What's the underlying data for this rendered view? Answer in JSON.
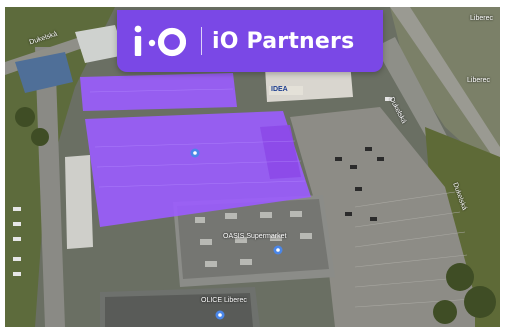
{
  "brand": {
    "logo_text": "i·O",
    "name": "iO Partners",
    "color": "#7a48e6"
  },
  "map_labels": {
    "street_top_left": "Dukelská",
    "store_sign": "IDEA",
    "street_right_upper": "Dukelská",
    "street_right_lower": "Dukelská",
    "city_top_right": "Liberec",
    "city_right": "Liberec",
    "building_pin_label": "OASIS Supermarket",
    "bottom_place_label": "OLICE Liberec"
  },
  "overlay": {
    "highlight_color": "#9b5cff"
  }
}
